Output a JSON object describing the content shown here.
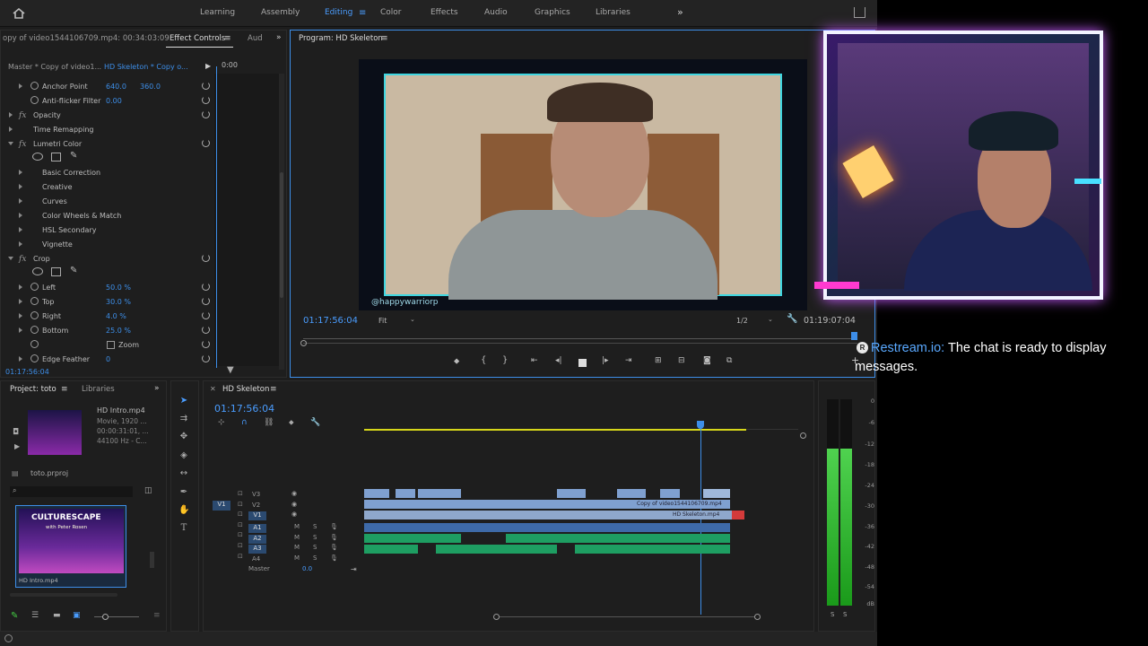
{
  "workspaces": [
    "Learning",
    "Assembly",
    "Editing",
    "Color",
    "Effects",
    "Audio",
    "Graphics",
    "Libraries"
  ],
  "active_workspace": "Editing",
  "effect_controls": {
    "source_label": "opy of video1544106709.mp4: 00:34:03:09",
    "tab_label": "Effect Controls",
    "tab2_label": "Aud",
    "master_label": "Master * Copy of video1...",
    "clip_label": "HD Skeleton * Copy o...",
    "time_label": "0:00",
    "rows": [
      {
        "name": "Anchor Point",
        "v1": "640.0",
        "v2": "360.0"
      },
      {
        "name": "Anti-flicker Filter",
        "v1": "0.00",
        "v2": ""
      },
      {
        "name": "Opacity",
        "v1": "",
        "v2": ""
      },
      {
        "name": "Time Remapping",
        "v1": "",
        "v2": ""
      },
      {
        "name": "Lumetri Color",
        "v1": "",
        "v2": ""
      },
      {
        "name": "Basic Correction",
        "v1": "",
        "v2": ""
      },
      {
        "name": "Creative",
        "v1": "",
        "v2": ""
      },
      {
        "name": "Curves",
        "v1": "",
        "v2": ""
      },
      {
        "name": "Color Wheels & Match",
        "v1": "",
        "v2": ""
      },
      {
        "name": "HSL Secondary",
        "v1": "",
        "v2": ""
      },
      {
        "name": "Vignette",
        "v1": "",
        "v2": ""
      },
      {
        "name": "Crop",
        "v1": "",
        "v2": ""
      },
      {
        "name": "Left",
        "v1": "50.0 %",
        "v2": ""
      },
      {
        "name": "Top",
        "v1": "30.0 %",
        "v2": ""
      },
      {
        "name": "Right",
        "v1": "4.0 %",
        "v2": ""
      },
      {
        "name": "Bottom",
        "v1": "25.0 %",
        "v2": ""
      },
      {
        "name": "Zoom",
        "v1": "",
        "v2": ""
      },
      {
        "name": "Edge Feather",
        "v1": "0",
        "v2": ""
      }
    ],
    "timecode": "01:17:56:04"
  },
  "program": {
    "title": "Program: HD Skeleton",
    "timecode": "01:17:56:04",
    "fit": "Fit",
    "resolution": "1/2",
    "duration": "01:19:07:04",
    "handle": "@happywarriorp"
  },
  "project": {
    "tab": "Project: toto",
    "tab2": "Libraries",
    "clip_name": "HD Intro.mp4",
    "clip_meta1": "Movie, 1920 ...",
    "clip_meta2": "00:00:31:01, ...",
    "clip_meta3": "44100 Hz - C...",
    "file": "toto.prproj",
    "thumb_title": "CULTURESCAPE",
    "thumb_sub": "with Peter Rosen",
    "thumb_label": "HD Intro.mp4"
  },
  "timeline": {
    "tab": "HD Skeleton",
    "timecode": "01:17:56:04",
    "tracks": [
      "V3",
      "V2",
      "V1",
      "A1",
      "A2",
      "A3",
      "A4"
    ],
    "source_patch": "V1",
    "master_label": "Master",
    "master_value": "0.0",
    "clip_copy": "Copy of video1544106709.mp4",
    "clip_skel": "HD Skeleton.mp4"
  },
  "meter_ticks": [
    "0",
    "-6",
    "-12",
    "-18",
    "-24",
    "-30",
    "-36",
    "-42",
    "-48",
    "-54",
    "dB"
  ],
  "meter_level": 0.76,
  "chat": {
    "source": "Restream.io:",
    "message": "The chat is ready to display messages."
  },
  "colors": {
    "accent": "#4a9dff",
    "audio": "#1e9e62",
    "video_clip": "#7fa0d0",
    "playhead": "#3d8ee8"
  }
}
